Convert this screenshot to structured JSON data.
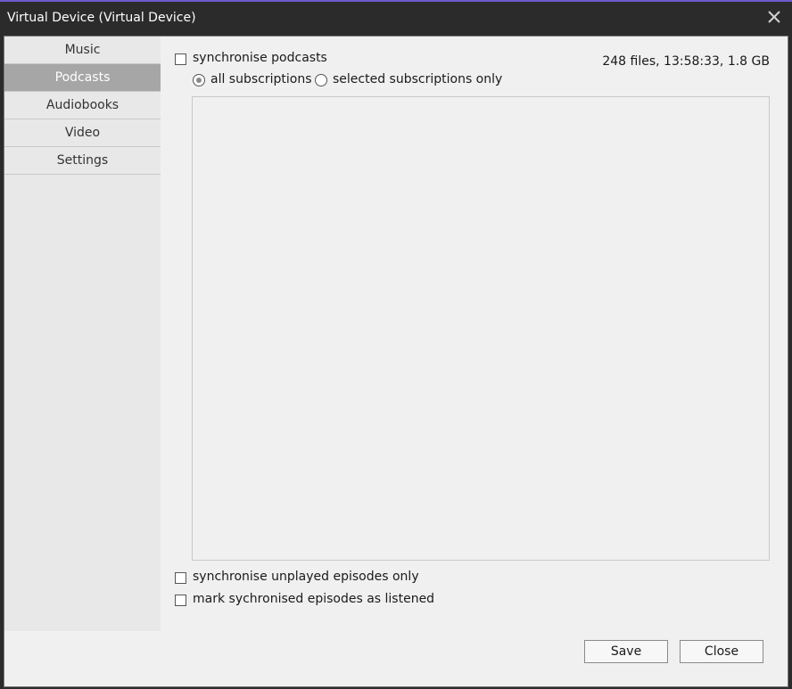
{
  "window": {
    "title": "Virtual Device (Virtual Device)"
  },
  "sidebar": {
    "items": [
      {
        "label": "Music",
        "active": false
      },
      {
        "label": "Podcasts",
        "active": true
      },
      {
        "label": "Audiobooks",
        "active": false
      },
      {
        "label": "Video",
        "active": false
      },
      {
        "label": "Settings",
        "active": false
      }
    ]
  },
  "podcasts": {
    "sync_label": "synchronise podcasts",
    "sync_checked": false,
    "stats": "248 files, 13:58:33, 1.8 GB",
    "radio_all_label": "all subscriptions",
    "radio_all_selected": true,
    "radio_selected_label": "selected subscriptions only",
    "radio_selected_selected": false,
    "unplayed_label": "synchronise unplayed episodes only",
    "unplayed_checked": false,
    "mark_listened_label": "mark sychronised episodes as listened",
    "mark_listened_checked": false
  },
  "footer": {
    "save_label": "Save",
    "close_label": "Close"
  },
  "icons": {
    "close": "close-icon"
  }
}
